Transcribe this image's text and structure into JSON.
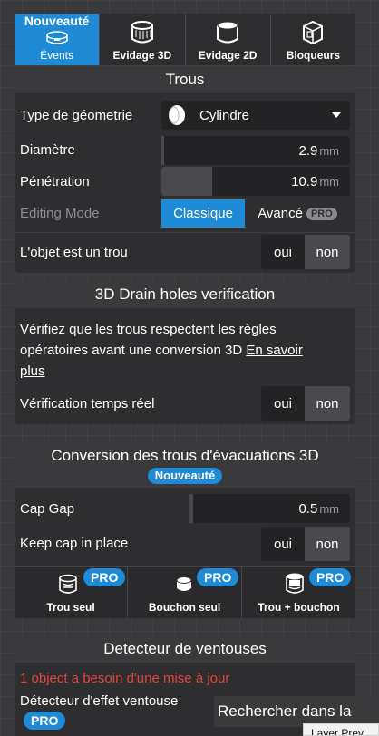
{
  "tabs": [
    {
      "label": "Évents",
      "badge": "Nouveauté",
      "icon": "vent-icon",
      "active": true
    },
    {
      "label": "Evidage 3D",
      "icon": "hollow-3d-icon"
    },
    {
      "label": "Evidage 2D",
      "icon": "hollow-2d-icon"
    },
    {
      "label": "Bloqueurs",
      "icon": "blocker-icon"
    }
  ],
  "trous": {
    "title": "Trous",
    "geometry_label": "Type de géometrie",
    "geometry_value": "Cylindre",
    "diameter_label": "Diamètre",
    "diameter_value": "2.9",
    "diameter_unit": "mm",
    "penetration_label": "Pénétration",
    "penetration_value": "10.9",
    "penetration_unit": "mm",
    "editing_label": "Editing Mode",
    "mode_classic": "Classique",
    "mode_advanced": "Avancé",
    "pro": "PRO",
    "is_hole_label": "L'objet est un trou",
    "oui": "oui",
    "non": "non"
  },
  "drain": {
    "title": "3D Drain holes verification",
    "desc_line1": "Vérifiez que les trous respectent les règles",
    "desc_line2": "opératoires avant une conversion 3D",
    "link_part1": "En savoir",
    "link_part2": "plus",
    "realtime_label": "Vérification temps réel",
    "oui": "oui",
    "non": "non"
  },
  "conversion": {
    "title": "Conversion des trous d'évacuations 3D",
    "badge": "Nouveauté",
    "cap_gap_label": "Cap Gap",
    "cap_gap_value": "0.5",
    "cap_gap_unit": "mm",
    "keep_cap_label": "Keep cap in place",
    "oui": "oui",
    "non": "non",
    "tools": [
      {
        "label": "Trou seul",
        "badge": "PRO",
        "icon": "single-hole-icon"
      },
      {
        "label": "Bouchon seul",
        "badge": "PRO",
        "icon": "cap-icon"
      },
      {
        "label": "Trou + bouchon",
        "badge": "PRO",
        "icon": "hole-and-cap-icon"
      }
    ]
  },
  "suction": {
    "title": "Detecteur de ventouses",
    "warning": "1 object a besoin d'une mise à jour",
    "detector_label": "Détecteur d'effet ventouse",
    "pro": "PRO",
    "warning_color": "#e0453a"
  },
  "search_overlay": "Rechercher dans la",
  "tooltip": "Layer Prev",
  "colors": {
    "accent": "#1f8ad6",
    "panel": "#2e2e31",
    "input": "#232326"
  }
}
